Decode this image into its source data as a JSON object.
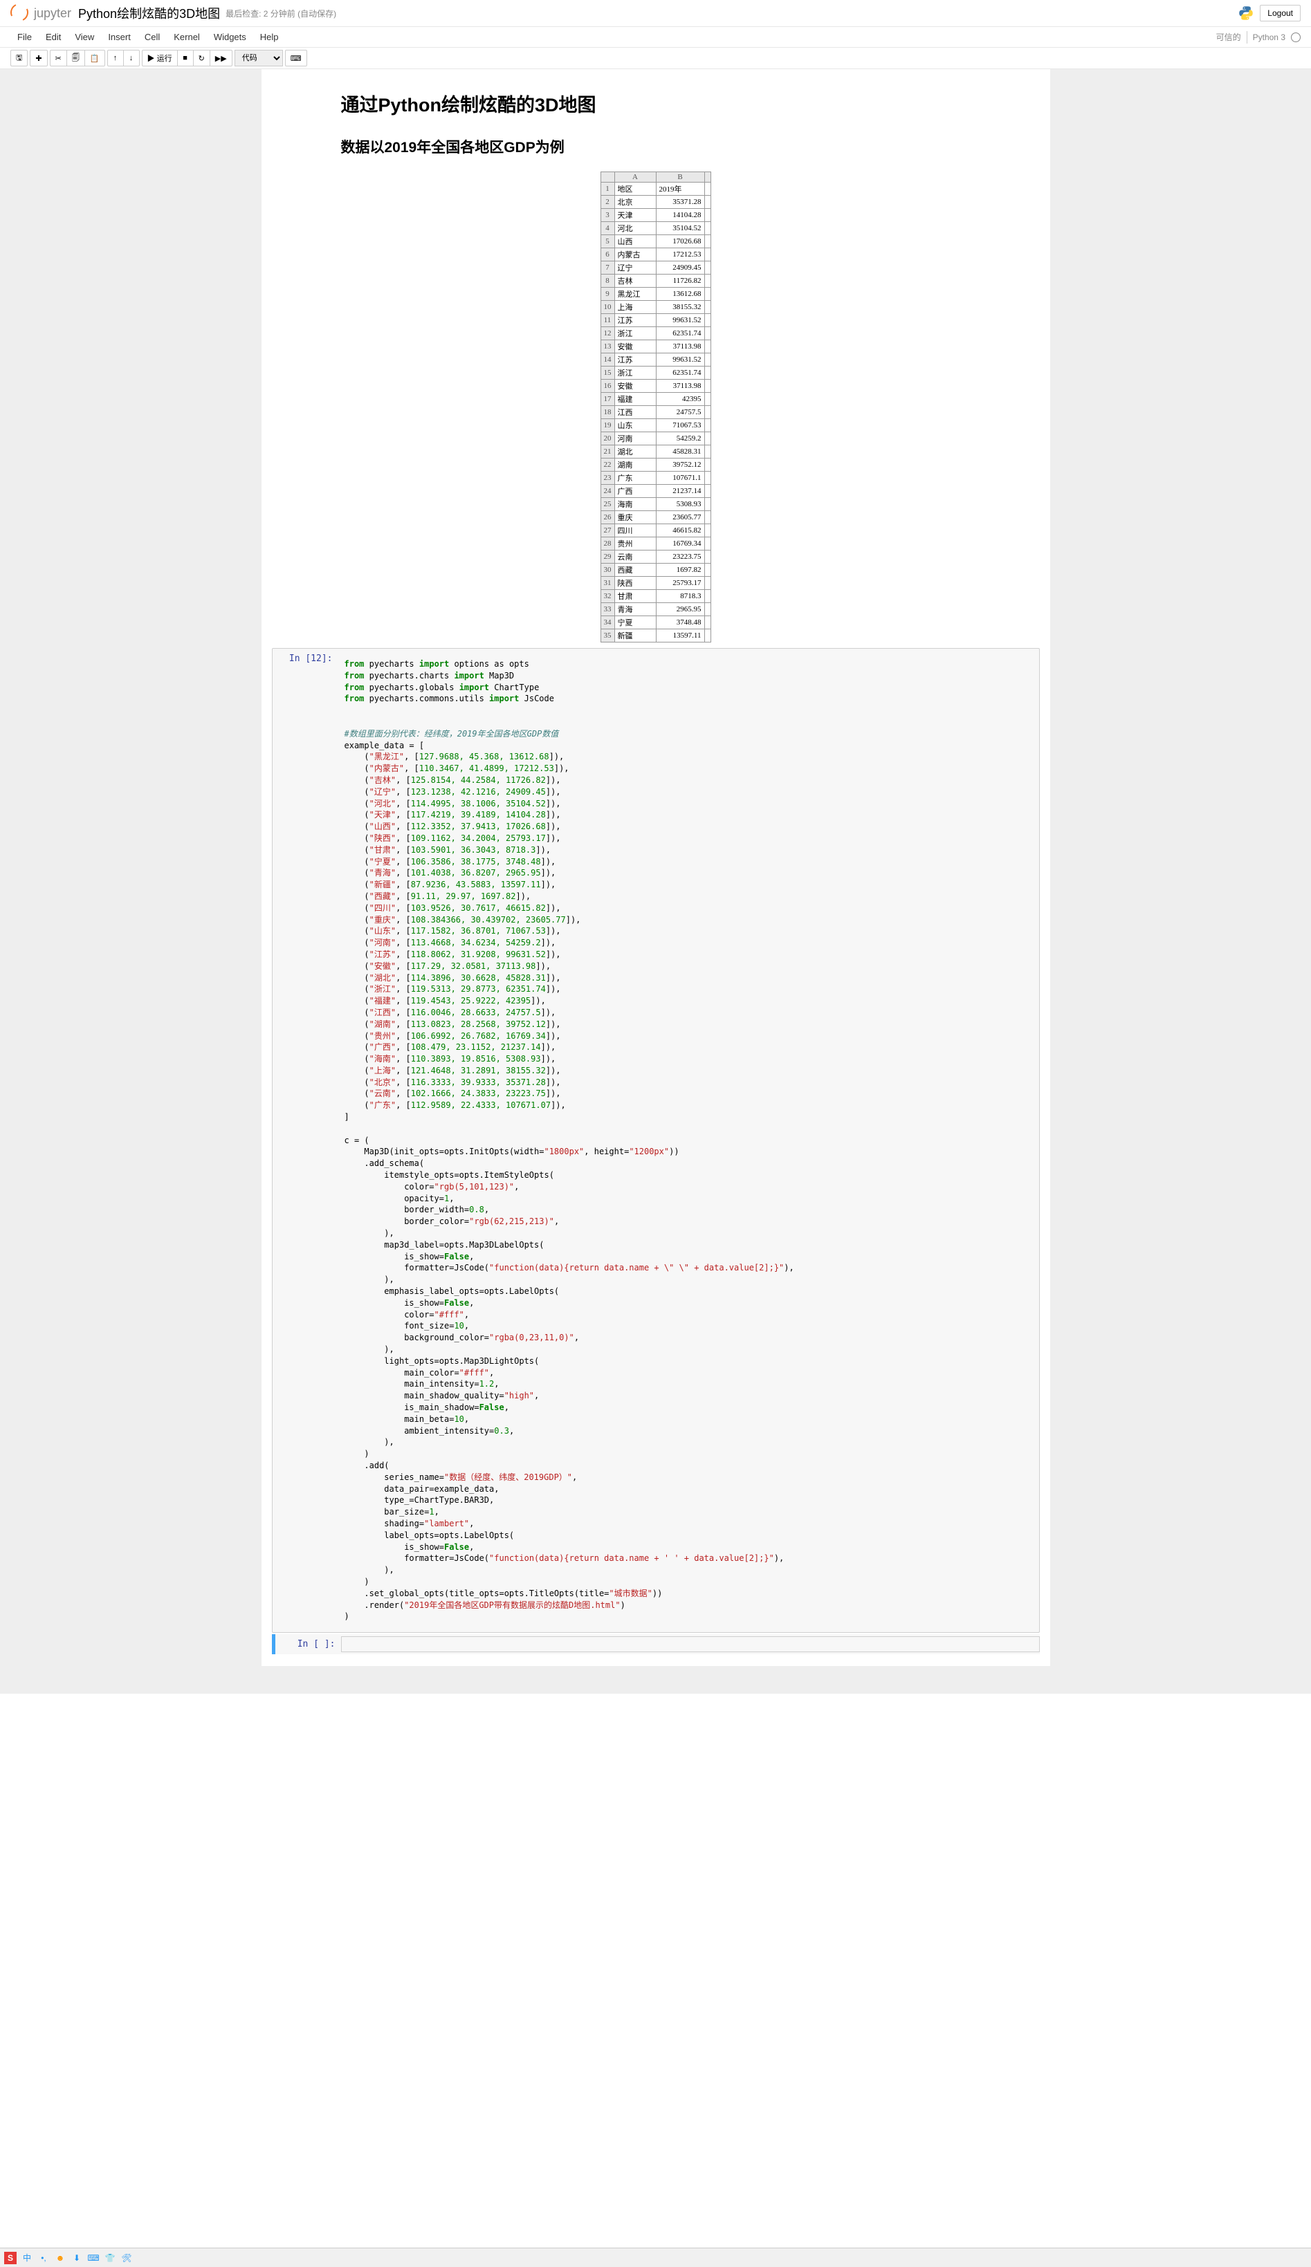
{
  "header": {
    "logo_text": "jupyter",
    "title": "Python绘制炫酷的3D地图",
    "checkpoint": "最后检查: 2 分钟前 (自动保存)",
    "logout": "Logout"
  },
  "menubar": {
    "items": [
      "File",
      "Edit",
      "View",
      "Insert",
      "Cell",
      "Kernel",
      "Widgets",
      "Help"
    ],
    "trusted": "可信的",
    "kernel": "Python 3"
  },
  "toolbar": {
    "run_label": "▶ 运行",
    "celltype": "代码"
  },
  "content": {
    "h1": "通过Python绘制炫酷的3D地图",
    "h2": "数据以2019年全国各地区GDP为例"
  },
  "table": {
    "col_a": "A",
    "col_b": "B",
    "hdr_region": "地区",
    "hdr_year": "2019年",
    "rows": [
      [
        "北京",
        "35371.28"
      ],
      [
        "天津",
        "14104.28"
      ],
      [
        "河北",
        "35104.52"
      ],
      [
        "山西",
        "17026.68"
      ],
      [
        "内蒙古",
        "17212.53"
      ],
      [
        "辽宁",
        "24909.45"
      ],
      [
        "吉林",
        "11726.82"
      ],
      [
        "黑龙江",
        "13612.68"
      ],
      [
        "上海",
        "38155.32"
      ],
      [
        "江苏",
        "99631.52"
      ],
      [
        "浙江",
        "62351.74"
      ],
      [
        "安徽",
        "37113.98"
      ],
      [
        "江苏",
        "99631.52"
      ],
      [
        "浙江",
        "62351.74"
      ],
      [
        "安徽",
        "37113.98"
      ],
      [
        "福建",
        "42395"
      ],
      [
        "江西",
        "24757.5"
      ],
      [
        "山东",
        "71067.53"
      ],
      [
        "河南",
        "54259.2"
      ],
      [
        "湖北",
        "45828.31"
      ],
      [
        "湖南",
        "39752.12"
      ],
      [
        "广东",
        "107671.1"
      ],
      [
        "广西",
        "21237.14"
      ],
      [
        "海南",
        "5308.93"
      ],
      [
        "重庆",
        "23605.77"
      ],
      [
        "四川",
        "46615.82"
      ],
      [
        "贵州",
        "16769.34"
      ],
      [
        "云南",
        "23223.75"
      ],
      [
        "西藏",
        "1697.82"
      ],
      [
        "陕西",
        "25793.17"
      ],
      [
        "甘肃",
        "8718.3"
      ],
      [
        "青海",
        "2965.95"
      ],
      [
        "宁夏",
        "3748.48"
      ],
      [
        "新疆",
        "13597.11"
      ]
    ]
  },
  "code": {
    "prompt": "In  [12]:",
    "empty_prompt": "In  [ ]:",
    "imports": [
      {
        "from": "pyecharts",
        "imp": "import",
        "what": "options as opts"
      },
      {
        "from": "pyecharts.charts",
        "imp": "import",
        "what": "Map3D"
      },
      {
        "from": "pyecharts.globals",
        "imp": "import",
        "what": "ChartType"
      },
      {
        "from": "pyecharts.commons.utils",
        "imp": "import",
        "what": "JsCode"
      }
    ],
    "comment": "#数组里面分别代表：经纬度，2019年全国各地区GDP数值",
    "example_data_label": "example_data = [",
    "data_rows": [
      [
        "黑龙江",
        "127.9688, 45.368, 13612.68"
      ],
      [
        "内蒙古",
        "110.3467, 41.4899, 17212.53"
      ],
      [
        "吉林",
        "125.8154, 44.2584, 11726.82"
      ],
      [
        "辽宁",
        "123.1238, 42.1216, 24909.45"
      ],
      [
        "河北",
        "114.4995, 38.1006, 35104.52"
      ],
      [
        "天津",
        "117.4219, 39.4189, 14104.28"
      ],
      [
        "山西",
        "112.3352, 37.9413, 17026.68"
      ],
      [
        "陕西",
        "109.1162, 34.2004, 25793.17"
      ],
      [
        "甘肃",
        "103.5901, 36.3043, 8718.3"
      ],
      [
        "宁夏",
        "106.3586, 38.1775, 3748.48"
      ],
      [
        "青海",
        "101.4038, 36.8207, 2965.95"
      ],
      [
        "新疆",
        "87.9236, 43.5883, 13597.11"
      ],
      [
        "西藏",
        "91.11, 29.97, 1697.82"
      ],
      [
        "四川",
        "103.9526, 30.7617, 46615.82"
      ],
      [
        "重庆",
        "108.384366, 30.439702, 23605.77"
      ],
      [
        "山东",
        "117.1582, 36.8701, 71067.53"
      ],
      [
        "河南",
        "113.4668, 34.6234, 54259.2"
      ],
      [
        "江苏",
        "118.8062, 31.9208, 99631.52"
      ],
      [
        "安徽",
        "117.29, 32.0581, 37113.98"
      ],
      [
        "湖北",
        "114.3896, 30.6628, 45828.31"
      ],
      [
        "浙江",
        "119.5313, 29.8773, 62351.74"
      ],
      [
        "福建",
        "119.4543, 25.9222, 42395"
      ],
      [
        "江西",
        "116.0046, 28.6633, 24757.5"
      ],
      [
        "湖南",
        "113.0823, 28.2568, 39752.12"
      ],
      [
        "贵州",
        "106.6992, 26.7682, 16769.34"
      ],
      [
        "广西",
        "108.479, 23.1152, 21237.14"
      ],
      [
        "海南",
        "110.3893, 19.8516, 5308.93"
      ],
      [
        "上海",
        "121.4648, 31.2891, 38155.32"
      ],
      [
        "北京",
        "116.3333, 39.9333, 35371.28"
      ],
      [
        "云南",
        "102.1666, 24.3833, 23223.75"
      ],
      [
        "广东",
        "112.9589, 22.4333, 107671.07"
      ]
    ],
    "chain": {
      "c_eq": "c = (",
      "map3d": "Map3D(init_opts=opts.InitOpts(width=",
      "w": "\"1800px\"",
      "h": "\"1200px\"",
      "add_schema": ".add_schema(",
      "itemstyle": "itemstyle_opts=opts.ItemStyleOpts(",
      "color": "color=",
      "color_v": "\"rgb(5,101,123)\"",
      "opacity": "opacity=",
      "opacity_v": "1",
      "border_width": "border_width=",
      "border_width_v": "0.8",
      "border_color": "border_color=",
      "border_color_v": "\"rgb(62,215,213)\"",
      "map3d_label": "map3d_label=opts.Map3DLabelOpts(",
      "is_show": "is_show=",
      "false": "False",
      "formatter": "formatter=JsCode(",
      "formatter_v": "\"function(data){return data.name + \\\" \\\" + data.value[2];}\"",
      "emphasis": "emphasis_label_opts=opts.LabelOpts(",
      "fff": "\"#fff\"",
      "font_size": "font_size=",
      "font_size_v": "10",
      "bg_color": "background_color=",
      "bg_color_v": "\"rgba(0,23,11,0)\"",
      "light": "light_opts=opts.Map3DLightOpts(",
      "main_color": "main_color=",
      "main_intensity": "main_intensity=",
      "main_intensity_v": "1.2",
      "shadow_q": "main_shadow_quality=",
      "shadow_q_v": "\"high\"",
      "is_main_shadow": "is_main_shadow=",
      "main_beta": "main_beta=",
      "main_beta_v": "10",
      "ambient": "ambient_intensity=",
      "ambient_v": "0.3",
      "add": ".add(",
      "series_name": "series_name=",
      "series_name_v": "\"数据（经度、纬度、2019GDP）\"",
      "data_pair": "data_pair=example_data,",
      "type": "type_=ChartType.BAR3D,",
      "bar_size": "bar_size=",
      "bar_size_v": "1",
      "shading": "shading=",
      "shading_v": "\"lambert\"",
      "label_opts": "label_opts=opts.LabelOpts(",
      "formatter2_v": "\"function(data){return data.name + ' ' + data.value[2];}\"",
      "global": ".set_global_opts(title_opts=opts.TitleOpts(title=",
      "global_v": "\"城市数据\"",
      "render": ".render(",
      "render_v": "\"2019年全国各地区GDP带有数据展示的炫酷D地图.html\""
    }
  }
}
